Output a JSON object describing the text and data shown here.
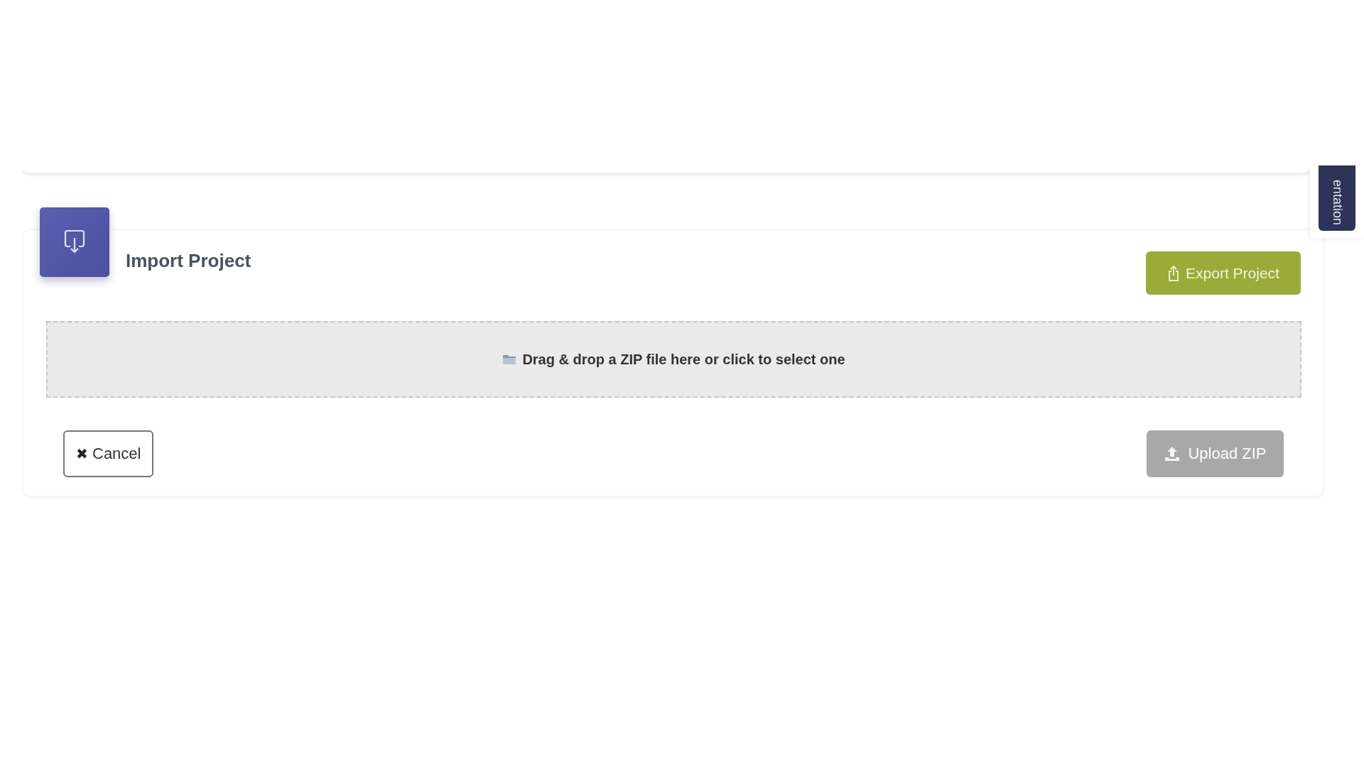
{
  "side_tab": {
    "label": "entation"
  },
  "import_panel": {
    "title": "Import Project",
    "export_button": {
      "label": "Export Project"
    },
    "dropzone": {
      "text": "Drag & drop a ZIP file here or click to select one"
    },
    "cancel_button": {
      "icon": "✖",
      "label": "Cancel"
    },
    "upload_button": {
      "label": "Upload ZIP",
      "disabled": true
    }
  }
}
